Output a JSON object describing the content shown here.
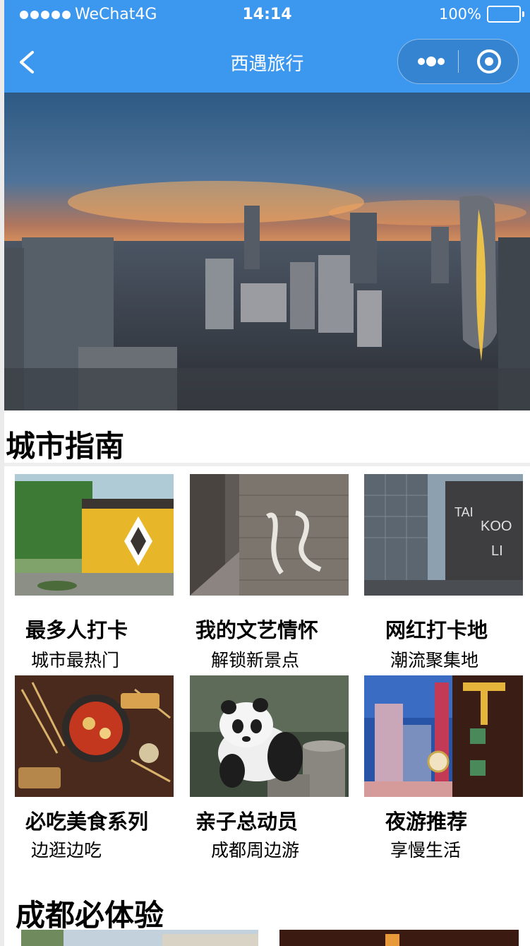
{
  "status_bar": {
    "carrier": "WeChat4G",
    "time": "14:14",
    "battery_text": "100%",
    "battery_level": 1.0
  },
  "nav": {
    "title": "西遇旅行",
    "back_icon": "chevron-left-icon",
    "more_icon": "more-dots-icon",
    "close_icon": "target-close-icon"
  },
  "colors": {
    "nav_bg": "#3c97ef",
    "page_bg": "#ffffff"
  },
  "banner": {
    "image": "city-skyline-sunset-photo"
  },
  "city_guide": {
    "title": "城市指南",
    "cards": [
      {
        "title": "最多人打卡",
        "subtitle": "城市最热门",
        "image": "temple-wall-photo"
      },
      {
        "title": "我的文艺情怀",
        "subtitle": "解锁新景点",
        "image": "alley-wall-calligraphy-photo"
      },
      {
        "title": "网红打卡地",
        "subtitle": "潮流聚集地",
        "image": "taikoo-li-photo"
      },
      {
        "title": "必吃美食系列",
        "subtitle": "边逛边吃",
        "image": "hotpot-skewers-photo"
      },
      {
        "title": "亲子总动员",
        "subtitle": "成都周边游",
        "image": "panda-photo"
      },
      {
        "title": "夜游推荐",
        "subtitle": "享慢生活",
        "image": "night-street-photo"
      }
    ]
  },
  "must_experience": {
    "title": "成都必体验"
  }
}
